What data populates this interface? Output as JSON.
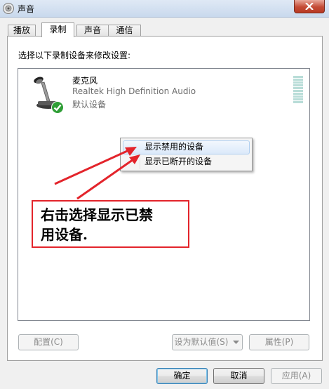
{
  "window": {
    "title": "声音",
    "icon": "speaker-icon",
    "close_icon": "close-icon"
  },
  "tabs": [
    {
      "label": "播放",
      "active": false
    },
    {
      "label": "录制",
      "active": true
    },
    {
      "label": "声音",
      "active": false
    },
    {
      "label": "通信",
      "active": false
    }
  ],
  "panel": {
    "instruction": "选择以下录制设备来修改设置:"
  },
  "device": {
    "name": "麦克风",
    "driver": "Realtek High Definition Audio",
    "status": "默认设备",
    "icon": "microphone-icon",
    "badge_icon": "green-check-icon"
  },
  "context_menu": {
    "items": [
      {
        "label": "显示禁用的设备",
        "highlighted": true
      },
      {
        "label": "显示已断开的设备",
        "highlighted": false
      }
    ]
  },
  "annotation": {
    "line1": "右击选择显示已禁",
    "line2": "用设备.",
    "color": "#e3242b"
  },
  "buttons": {
    "configure": "配置(C)",
    "set_default": "设为默认值(S)",
    "properties": "属性(P)",
    "ok": "确定",
    "cancel": "取消",
    "apply": "应用(A)"
  }
}
